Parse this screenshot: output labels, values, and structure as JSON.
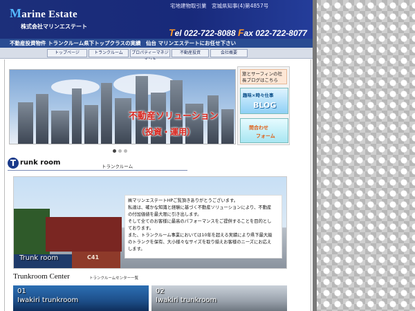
{
  "header": {
    "logo_cap": "M",
    "logo_rest": "arine Estate",
    "company": "株式会社マリンエステート",
    "license": "宅地建物取引業　宮城県知事(4)第4857号",
    "tel_cap": "T",
    "tel_rest": "el 022-722-8088",
    "fax_cap": "F",
    "fax_rest": "ax 022-722-8077"
  },
  "tagline": "不動産投資物件 トランクルーム県下トップクラスの実績　仙台 マリンエステートにお任せ下さい",
  "nav": [
    {
      "label": "トップページ"
    },
    {
      "label": "トランクルーム"
    },
    {
      "label": "プロパティーマネジメント"
    },
    {
      "label": "不動産投資"
    },
    {
      "label": "会社概要"
    }
  ],
  "hero": {
    "title": "不動産ソリューション",
    "subtitle": "（投資・運用）"
  },
  "sidebar": {
    "blog_note": "旅とサーフィンの社長ブログはこちら",
    "blog_banner_line1": "趣味×時々仕事",
    "blog_banner_line2": "BLOG",
    "form_line1": "問合わせ",
    "form_line2": "フォーム"
  },
  "trunk_section": {
    "icon_letter": "T",
    "title": "runk room",
    "subtitle": "トランクルーム",
    "banner_caption": "Trunk room",
    "container_text": "C41",
    "greeting": [
      "㈱マリンエステートHPご覧頂きありがとうございます。",
      "私達は、確かな知識と経験に基づく不動産ソリューションにより、不動産",
      "の付加価値を最大限に引き出します。",
      "そして全てのお客様に最高のパフォーマンスをご提供することを目的とし",
      "ております。",
      "また、トランクルーム事業においては10年を超える実績により県下最大級",
      "のトランクを保有、大小様々なサイズを取り揃えお客様のニーズにお応え",
      "します。"
    ]
  },
  "center_section": {
    "title": "Trunkroom Center",
    "subtitle": "トランクルームセンター一覧",
    "cards": [
      {
        "number": "01",
        "name": "Iwakiri trunkroom"
      },
      {
        "number": "02",
        "name": "Iwakiri trunkroom"
      }
    ]
  },
  "colors": {
    "header_bg": "#1c2f7a",
    "accent_orange": "#ff9a2a",
    "hero_text_red": "#d8261e",
    "logo_cap_blue": "#55b8ff"
  }
}
